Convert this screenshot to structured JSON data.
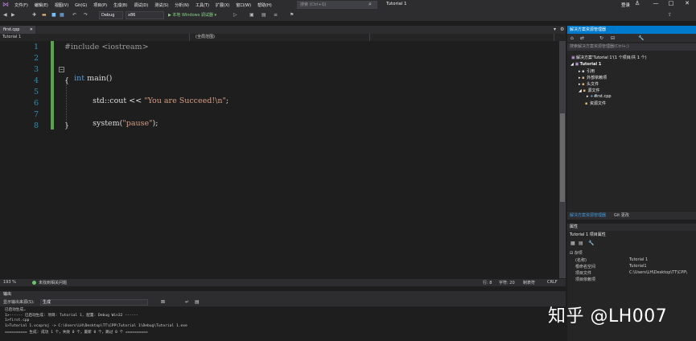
{
  "menu": [
    "文件(F)",
    "编辑(E)",
    "视图(V)",
    "Git(G)",
    "项目(P)",
    "生成(B)",
    "调试(D)",
    "测试(S)",
    "分析(N)",
    "工具(T)",
    "扩展(X)",
    "窗口(W)",
    "帮助(H)"
  ],
  "search": {
    "placeholder": "搜索 (Ctrl+Q)"
  },
  "window_title": "Tutorial 1",
  "signin": "登录",
  "toolbar": {
    "config": "Debug",
    "platform": "x86",
    "run_label": "▶ 本地 Windows 调试器 ▾"
  },
  "doc_tab": "first.cpp",
  "nav": {
    "project": "Tutorial 1",
    "scope": "(全局范围)"
  },
  "code_lines": [
    {
      "n": "1",
      "text": "#include <iostream>"
    },
    {
      "n": "2",
      "text": ""
    },
    {
      "n": "3",
      "kw": "int",
      "rest": " main()"
    },
    {
      "n": "4",
      "text": "{"
    },
    {
      "n": "5",
      "pre": "std::cout << ",
      "str": "\"You are Succeed!\\n\"",
      "post": ";"
    },
    {
      "n": "6",
      "text": ""
    },
    {
      "n": "7",
      "pre": "system(",
      "str": "\"pause\"",
      "post": ");"
    },
    {
      "n": "8",
      "text": "}"
    }
  ],
  "editor_status": {
    "zoom": "193 %",
    "issues": "未找到相关问题",
    "line": "行: 8",
    "char": "字符: 20",
    "col": "制表符",
    "eol": "CRLF"
  },
  "output": {
    "title": "输出",
    "source_label": "显示输出来源(S):",
    "source_value": "生成",
    "lines": [
      "已启动生成…",
      "1>------ 已启动生成: 项目: Tutorial 1, 配置: Debug Win32 ------",
      "1>first.cpp",
      "1>Tutorial 1.vcxproj -> C:\\Users\\LH\\Desktop\\TT\\CPP\\Tutorial 1\\Debug\\Tutorial 1.exe",
      "========== 生成: 成功 1 个，失败 0 个，最新 0 个，跳过 0 个 =========="
    ]
  },
  "solution_explorer": {
    "title": "解决方案资源管理器",
    "search_placeholder": "搜索解决方案资源管理器(Ctrl+;)",
    "items": [
      {
        "label": "解决方案'Tutorial 1'(1 个项目/共 1 个)"
      },
      {
        "label": "Tutorial 1"
      },
      {
        "label": "引用"
      },
      {
        "label": "外部依赖项"
      },
      {
        "label": "头文件"
      },
      {
        "label": "源文件"
      },
      {
        "label": "first.cpp"
      },
      {
        "label": "资源文件"
      }
    ],
    "tab_active": "解决方案资源管理器",
    "tab_other": "Git 更改"
  },
  "properties": {
    "title": "属性",
    "selector": "Tutorial 1  项目属性",
    "section": "杂项",
    "rows": [
      {
        "name": "(名称)",
        "value": "Tutorial 1"
      },
      {
        "name": "根命名空间",
        "value": "Tutorial1"
      },
      {
        "name": "项目文件",
        "value": "C:\\Users\\LH\\Desktop\\TT\\CPP\\"
      },
      {
        "name": "项目依赖项",
        "value": ""
      }
    ]
  },
  "watermark": "知乎 @LH007",
  "colors": {
    "accent": "#007acc",
    "keyword": "#569cd6",
    "string": "#d69d85",
    "linenum": "#2b91af",
    "changebar": "#57a64a"
  }
}
